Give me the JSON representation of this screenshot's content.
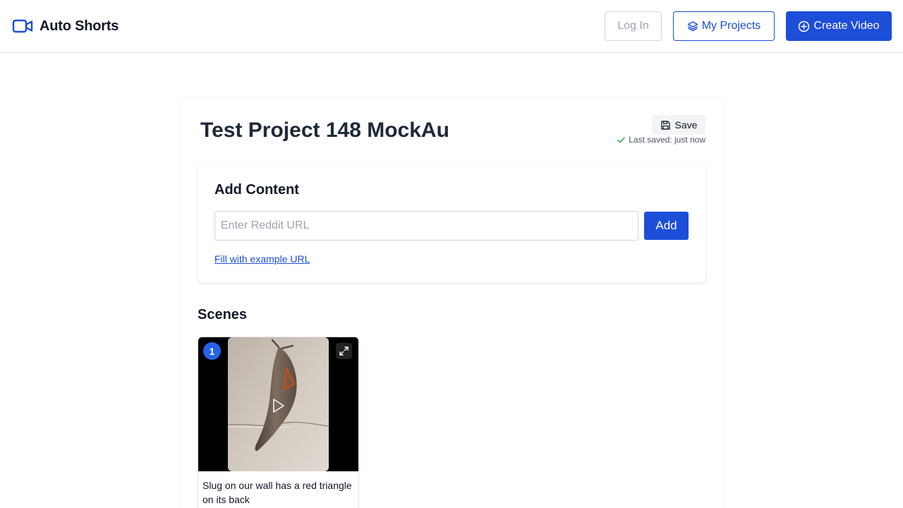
{
  "app": {
    "name": "Auto Shorts",
    "logo_icon": "video-camera-icon",
    "accent_color": "#1d4ed8"
  },
  "nav": {
    "login_label": "Log In",
    "projects_label": "My Projects",
    "projects_icon": "layers-icon",
    "create_label": "Create Video",
    "create_icon": "plus-circle-icon"
  },
  "project": {
    "title": "Test Project 148 MockAu",
    "save_label": "Save",
    "save_icon": "floppy-disk-icon",
    "last_saved": "Last saved: just now",
    "status_color": "#16a34a"
  },
  "add_content": {
    "title": "Add Content",
    "input_placeholder": "Enter Reddit URL",
    "input_value": "",
    "add_label": "Add",
    "example_link": "Fill with example URL"
  },
  "scenes": {
    "title": "Scenes",
    "items": [
      {
        "number": "1",
        "caption": "Slug on our wall has a red triangle on its back",
        "expand_icon": "expand-icon",
        "play_icon": "play-icon"
      }
    ]
  }
}
